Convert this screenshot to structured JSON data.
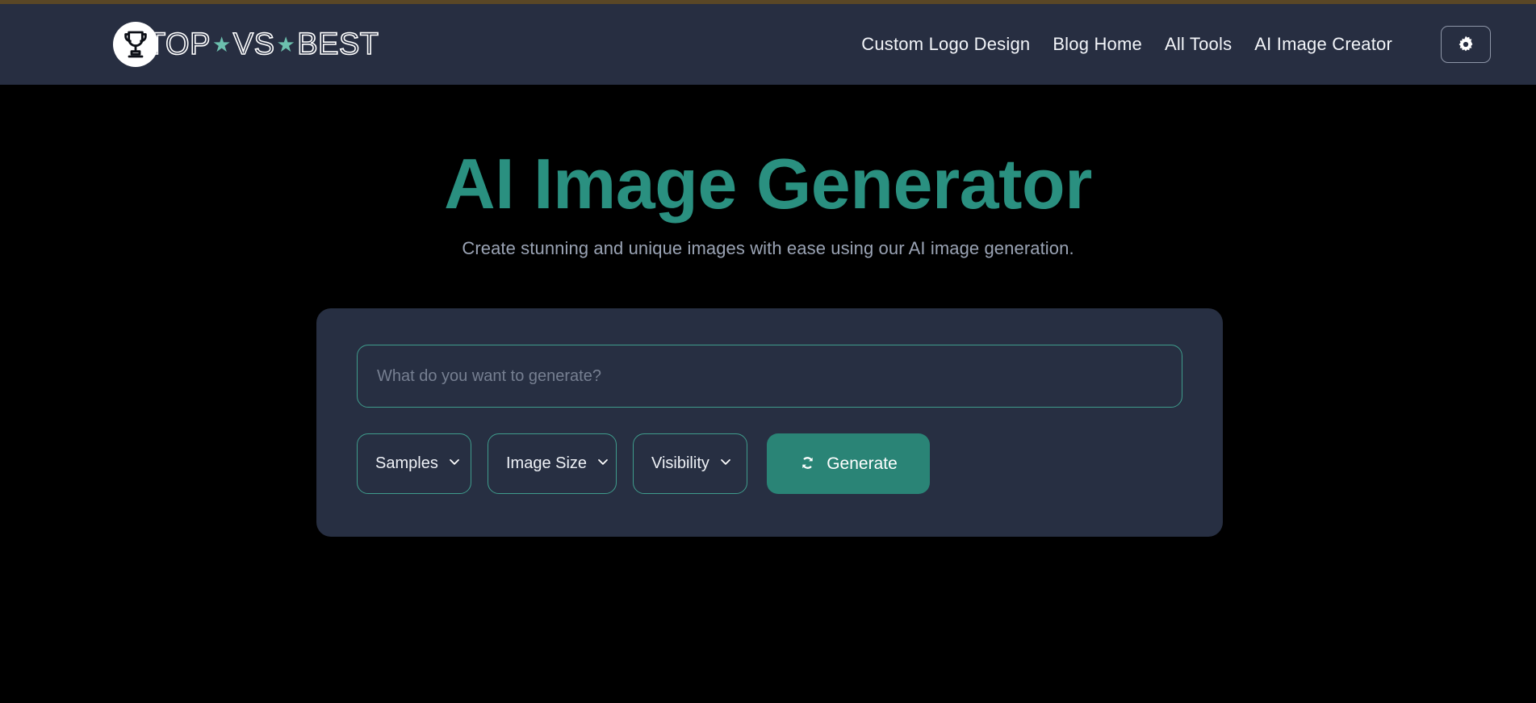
{
  "header": {
    "brand": {
      "icon": "trophy-icon",
      "text_before": "TOP",
      "star": "★",
      "text_middle": "VS",
      "text_after": "BEST"
    },
    "nav": [
      {
        "label": "Custom Logo Design",
        "name": "nav-custom-logo-design"
      },
      {
        "label": "Blog Home",
        "name": "nav-blog-home"
      },
      {
        "label": "All Tools",
        "name": "nav-all-tools"
      },
      {
        "label": "AI Image Creator",
        "name": "nav-ai-image-creator"
      }
    ],
    "theme_toggle": {
      "icon": "sun-gear-icon",
      "aria_label": "Toggle theme"
    },
    "background_color": "#272e41",
    "accent_strip_color": "#5a4726"
  },
  "hero": {
    "title": "AI Image Generator",
    "subtitle": "Create stunning and unique images with ease using our AI image generation.",
    "title_color": "#2a9080",
    "subtitle_color": "#9aa3b4"
  },
  "generator": {
    "prompt": {
      "value": "",
      "placeholder": "What do you want to generate?"
    },
    "selects": [
      {
        "label": "Samples",
        "name": "samples-select",
        "icon": "chevron-down-icon"
      },
      {
        "label": "Image Size",
        "name": "image-size-select",
        "icon": "chevron-down-icon"
      },
      {
        "label": "Visibility",
        "name": "visibility-select",
        "icon": "chevron-down-icon"
      }
    ],
    "generate_button": {
      "label": "Generate",
      "icon": "refresh-icon",
      "color": "#2a8476"
    },
    "panel_color": "#272f42",
    "border_color": "#3f9c8c"
  },
  "page": {
    "background_color": "#000000"
  }
}
